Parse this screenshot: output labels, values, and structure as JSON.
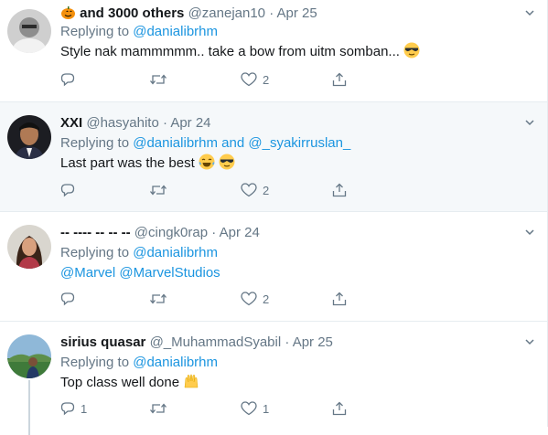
{
  "tweets": [
    {
      "name": "and 3000 others",
      "handle": "@zanejan10",
      "dot": "·",
      "date": "Apr 25",
      "replying_prefix": "Replying to",
      "replying_to": [
        "@danialibrhm"
      ],
      "replying_and": "",
      "text": "Style nak mammmmm.. take a bow from uitm somban...",
      "reply_count": "",
      "retweet_count": "",
      "like_count": "2",
      "highlighted": false
    },
    {
      "name": "XXI",
      "handle": "@hasyahito",
      "dot": "·",
      "date": "Apr 24",
      "replying_prefix": "Replying to",
      "replying_to": [
        "@danialibrhm",
        "@_syakirruslan_"
      ],
      "replying_and": "and",
      "text": "Last part was the best",
      "reply_count": "",
      "retweet_count": "",
      "like_count": "2",
      "highlighted": true
    },
    {
      "name": "-- ---- -- -- --",
      "handle": "@cingk0rap",
      "dot": "·",
      "date": "Apr 24",
      "replying_prefix": "Replying to",
      "replying_to": [
        "@danialibrhm"
      ],
      "replying_and": "",
      "text_mentions": [
        "@Marvel",
        "@MarvelStudios"
      ],
      "reply_count": "",
      "retweet_count": "",
      "like_count": "2",
      "highlighted": false
    },
    {
      "name": "sirius quasar",
      "handle": "@_MuhammadSyabil",
      "dot": "·",
      "date": "Apr 25",
      "replying_prefix": "Replying to",
      "replying_to": [
        "@danialibrhm"
      ],
      "replying_and": "",
      "text": "Top class well done",
      "reply_count": "1",
      "retweet_count": "",
      "like_count": "1",
      "highlighted": false
    }
  ],
  "icons": {
    "reply": "reply-icon",
    "retweet": "retweet-icon",
    "like": "heart-icon",
    "share": "share-icon",
    "more": "chevron-down-icon"
  },
  "colors": {
    "link": "#1b95e0",
    "secondary": "#657786",
    "highlight_bg": "#f5f8fa",
    "border": "#e6ecf0"
  }
}
